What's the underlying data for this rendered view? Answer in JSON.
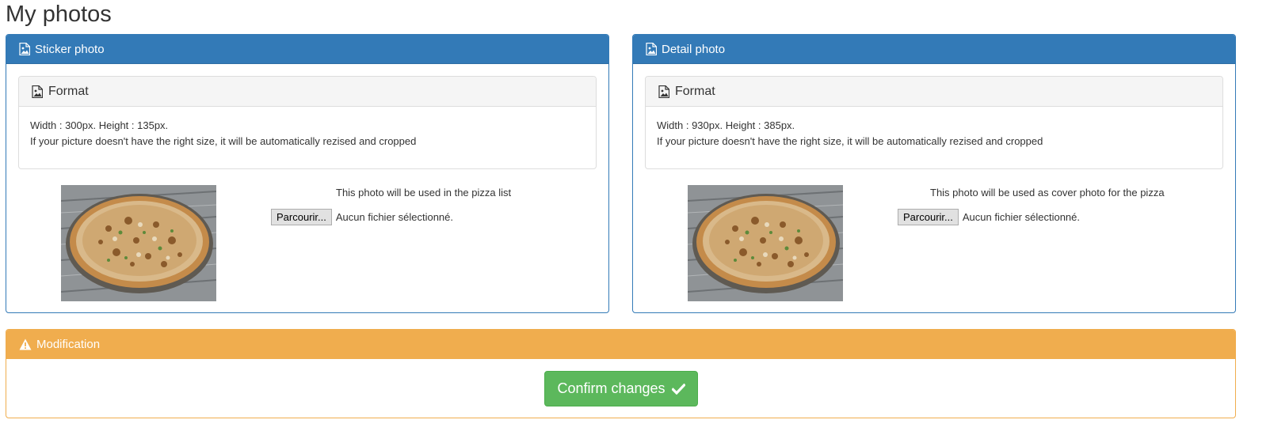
{
  "page": {
    "title": "My photos"
  },
  "sticker_panel": {
    "title": "Sticker photo",
    "icon": "image-icon",
    "format": {
      "title": "Format",
      "icon": "image-icon",
      "dimensions": "Width : 300px. Height : 135px.",
      "note": "If your picture doesn't have the right size, it will be automatically rezised and cropped"
    },
    "usage_text": "This photo will be used in the pizza list",
    "file_button": "Parcourir...",
    "file_status": "Aucun fichier sélectionné."
  },
  "detail_panel": {
    "title": "Detail photo",
    "icon": "image-icon",
    "format": {
      "title": "Format",
      "icon": "image-icon",
      "dimensions": "Width : 930px. Height : 385px.",
      "note": "If your picture doesn't have the right size, it will be automatically rezised and cropped"
    },
    "usage_text": "This photo will be used as cover photo for the pizza",
    "file_button": "Parcourir...",
    "file_status": "Aucun fichier sélectionné."
  },
  "modification_panel": {
    "title": "Modification",
    "icon": "warning-icon",
    "confirm_label": "Confirm changes",
    "confirm_icon": "checkmark-icon"
  },
  "colors": {
    "primary": "#337ab7",
    "warning": "#f0ad4e",
    "success": "#5cb85c"
  }
}
